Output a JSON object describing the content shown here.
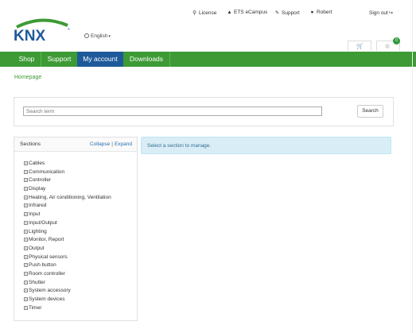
{
  "brand": {
    "logo_text": "KNX",
    "green": "#3d9a35",
    "blue": "#1e5a9a"
  },
  "language": {
    "label": "English"
  },
  "toplinks": {
    "license": "License",
    "ets": "ETS eCampus",
    "support": "Support",
    "user": "Robert",
    "signout": "Sign out"
  },
  "cart": {
    "badge": "0"
  },
  "nav": {
    "shop": "Shop",
    "support": "Support",
    "account": "My account",
    "downloads": "Downloads"
  },
  "breadcrumb": "Homepage",
  "search": {
    "placeholder": "Search term",
    "button": "Search"
  },
  "sections": {
    "title": "Sections",
    "collapse": "Collapse",
    "separator": "|",
    "expand": "Expand",
    "items": [
      "Cables",
      "Communication",
      "Controller",
      "Display",
      "Heating, Air conditioning, Ventilation",
      "Infrared",
      "Input",
      "Input/Output",
      "Lighting",
      "Monitor, Report",
      "Output",
      "Physical sensors",
      "Push button",
      "Room controller",
      "Shutter",
      "System accessory",
      "System devices",
      "Timer"
    ]
  },
  "info_message": "Select a section to manage."
}
